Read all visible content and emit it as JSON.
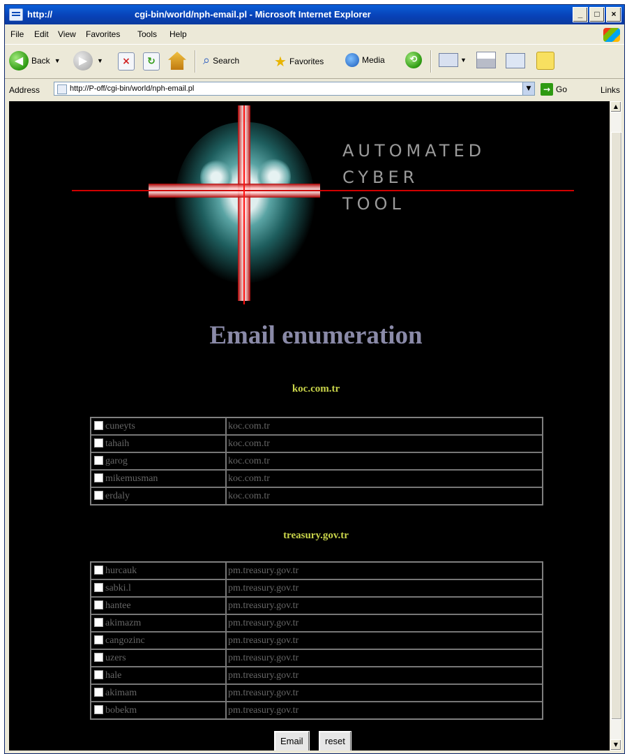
{
  "window": {
    "title_prefix": "http://",
    "title": "cgi-bin/world/nph-email.pl - Microsoft Internet Explorer",
    "buttons": [
      "_",
      "□",
      "×"
    ]
  },
  "menu": [
    "File",
    "Edit",
    "View",
    "Favorites",
    "Tools",
    "Help"
  ],
  "toolbar": {
    "back": "Back",
    "search": "Search",
    "favorites": "Favorites",
    "media": "Media"
  },
  "address": {
    "label": "Address",
    "url": "http://P-off/cgi-bin/world/nph-email.pl",
    "go": "Go",
    "links": "Links"
  },
  "logo": {
    "line1": "Automated",
    "line2": "Cyber",
    "line3": "Tool"
  },
  "page": {
    "title": "Email enumeration",
    "submit_label": "Email",
    "reset_label": "reset"
  },
  "groups": [
    {
      "domain": "koc.com.tr",
      "rows": [
        {
          "user": "cuneyts",
          "domain": "koc.com.tr"
        },
        {
          "user": "tahaih",
          "domain": "koc.com.tr"
        },
        {
          "user": "garog",
          "domain": "koc.com.tr"
        },
        {
          "user": "mikemusman",
          "domain": "koc.com.tr"
        },
        {
          "user": "erdaly",
          "domain": "koc.com.tr"
        }
      ]
    },
    {
      "domain": "treasury.gov.tr",
      "rows": [
        {
          "user": "hurcauk",
          "domain": "pm.treasury.gov.tr"
        },
        {
          "user": "sabki.l",
          "domain": "pm.treasury.gov.tr"
        },
        {
          "user": "hantee",
          "domain": "pm.treasury.gov.tr"
        },
        {
          "user": "akimazm",
          "domain": "pm.treasury.gov.tr"
        },
        {
          "user": "cangozinc",
          "domain": "pm.treasury.gov.tr"
        },
        {
          "user": "uzers",
          "domain": "pm.treasury.gov.tr"
        },
        {
          "user": "hale",
          "domain": "pm.treasury.gov.tr"
        },
        {
          "user": "akimam",
          "domain": "pm.treasury.gov.tr"
        },
        {
          "user": "bobekm",
          "domain": "pm.treasury.gov.tr"
        }
      ]
    }
  ]
}
